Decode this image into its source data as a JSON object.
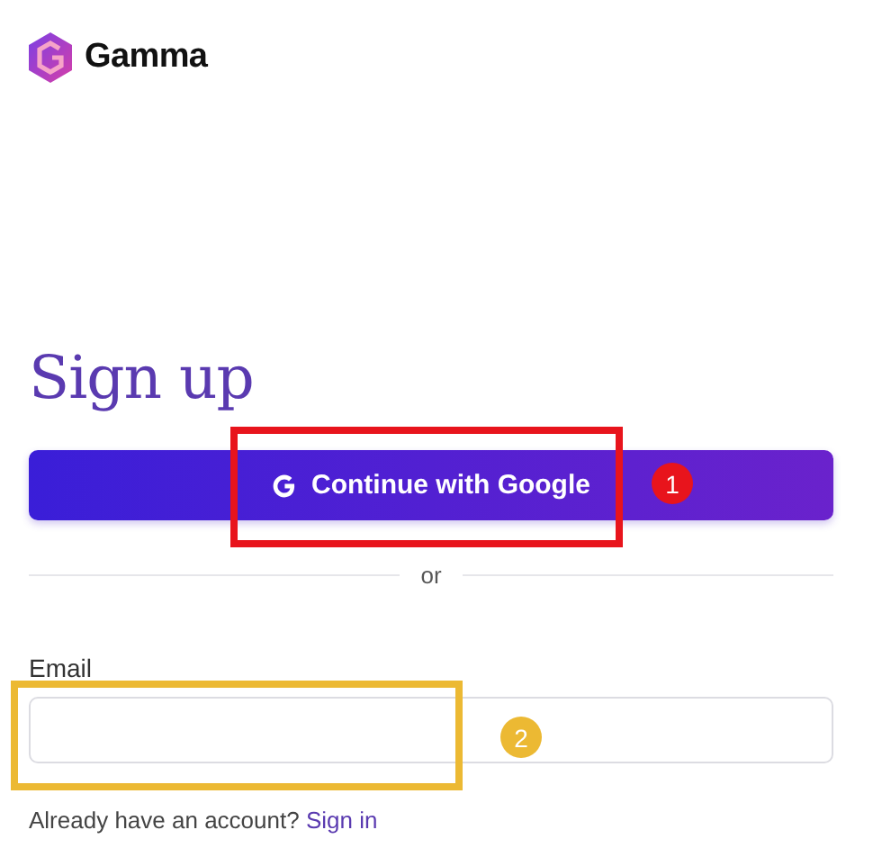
{
  "brand": {
    "name": "Gamma"
  },
  "heading": "Sign up",
  "google_button": {
    "label": "Continue with Google"
  },
  "divider": {
    "label": "or"
  },
  "email": {
    "label": "Email"
  },
  "footer": {
    "text": "Already have an account?",
    "link": "Sign in"
  },
  "annotations": [
    {
      "number": "1",
      "color": "#e8141c"
    },
    {
      "number": "2",
      "color": "#ecb933"
    }
  ]
}
